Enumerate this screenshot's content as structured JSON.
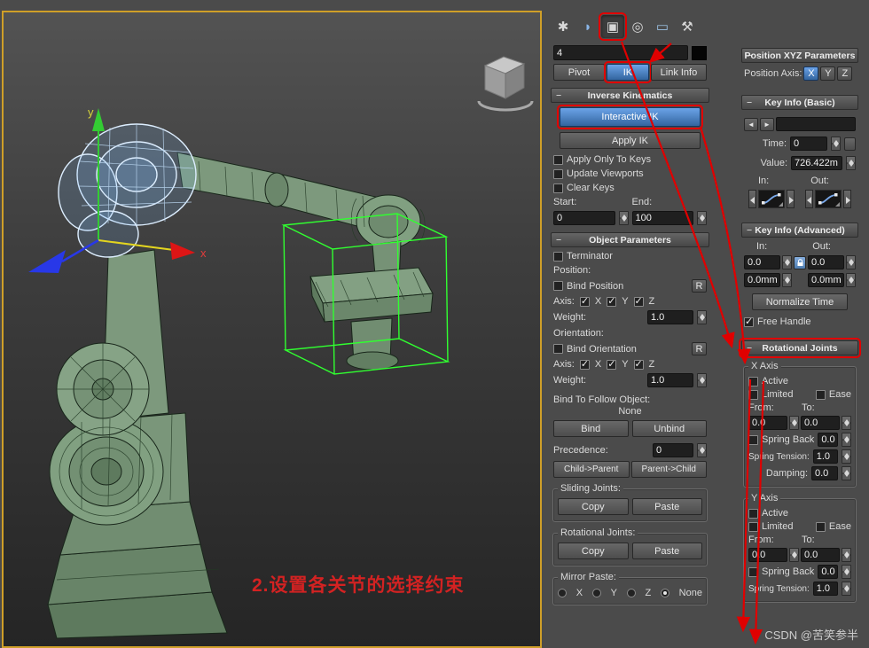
{
  "watermark": "CSDN @苦笑参半",
  "viewport": {
    "annotation": "2.设置各关节的选择约束",
    "axis_x": "x",
    "axis_y": "y"
  },
  "tabs": [
    {
      "name": "create",
      "glyph": "✱"
    },
    {
      "name": "modify",
      "glyph": "◗"
    },
    {
      "name": "hierarchy",
      "glyph": "▣"
    },
    {
      "name": "motion",
      "glyph": "◎"
    },
    {
      "name": "display",
      "glyph": "▭"
    },
    {
      "name": "utilities",
      "glyph": "⚒"
    }
  ],
  "panel": {
    "object_name": "4",
    "modes": {
      "pivot": "Pivot",
      "ik": "IK",
      "link_info": "Link Info"
    }
  },
  "ik": {
    "title": "Inverse Kinematics",
    "interactive_ik": "Interactive IK",
    "apply_ik": "Apply IK",
    "apply_only_to_keys": "Apply Only To Keys",
    "update_viewports": "Update Viewports",
    "clear_keys": "Clear Keys",
    "start_label": "Start:",
    "end_label": "End:",
    "start_value": "0",
    "end_value": "100"
  },
  "object_params": {
    "title": "Object Parameters",
    "terminator": "Terminator",
    "position_label": "Position:",
    "bind_position": "Bind Position",
    "r_label": "R",
    "axis_label": "Axis:",
    "x": "X",
    "y": "Y",
    "z": "Z",
    "weight_label": "Weight:",
    "position_weight": "1.0",
    "orientation_label": "Orientation:",
    "bind_orientation": "Bind Orientation",
    "orientation_weight": "1.0",
    "bind_follow_label": "Bind To Follow Object:",
    "follow_object": "None",
    "bind": "Bind",
    "unbind": "Unbind",
    "precedence_label": "Precedence:",
    "precedence_value": "0",
    "child_parent": "Child->Parent",
    "parent_child": "Parent->Child"
  },
  "joint_copy": {
    "sliding_label": "Sliding Joints:",
    "rotational_label": "Rotational Joints:",
    "copy": "Copy",
    "paste": "Paste",
    "mirror_label": "Mirror Paste:",
    "x": "X",
    "y": "Y",
    "z": "Z",
    "none": "None"
  },
  "pos_xyz": {
    "title": "Position XYZ Parameters",
    "axis_label": "Position Axis:",
    "x": "X",
    "y": "Y",
    "z": "Z"
  },
  "key_basic": {
    "title": "Key Info (Basic)",
    "prev": "◄",
    "next": "►",
    "time_label": "Time:",
    "time_value": "0",
    "value_label": "Value:",
    "value_value": "726.422m",
    "in_label": "In:",
    "out_label": "Out:"
  },
  "key_adv": {
    "title": "Key Info (Advanced)",
    "in_label": "In:",
    "out_label": "Out:",
    "in_value": "0.0",
    "out_value": "0.0",
    "in_mm": "0.0mm",
    "out_mm": "0.0mm",
    "normalize": "Normalize Time",
    "free_handle": "Free Handle"
  },
  "rot_joints": {
    "title": "Rotational Joints",
    "x": {
      "label": "X Axis",
      "active": "Active",
      "limited": "Limited",
      "ease": "Ease",
      "from_label": "From:",
      "to_label": "To:",
      "from_value": "0.0",
      "to_value": "0.0",
      "spring_back": "Spring Back",
      "spring_back_value": "0.0",
      "spring_tension_label": "Spring Tension:",
      "spring_tension_value": "1.0",
      "damping_label": "Damping:",
      "damping_value": "0.0"
    },
    "y": {
      "label": "Y Axis",
      "active": "Active",
      "limited": "Limited",
      "ease": "Ease",
      "from_label": "From:",
      "to_label": "To:",
      "from_value": "0.0",
      "to_value": "0.0",
      "spring_back": "Spring Back",
      "spring_back_value": "0.0",
      "spring_tension_label": "Spring Tension:",
      "spring_tension_value": "1.0"
    }
  }
}
